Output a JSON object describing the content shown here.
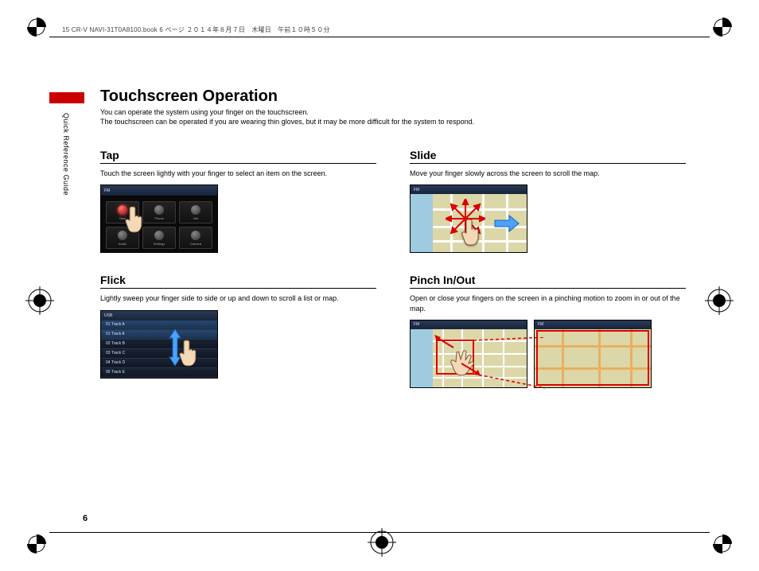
{
  "header_meta": "15 CR-V NAVI-31T0A8100.book  6 ページ  ２０１４年８月７日　木曜日　午前１０時５０分",
  "vertical_label": "Quick Reference Guide",
  "page_number": "6",
  "title": "Touchscreen Operation",
  "intro_line1": "You can operate the system using your finger on the touchscreen.",
  "intro_line2": "The touchscreen can be operated if you are wearing thin gloves, but it may be more difficult for the system to respond.",
  "sections": {
    "tap": {
      "heading": "Tap",
      "desc": "Touch the screen lightly with your finger to select an item on the screen.",
      "cells": [
        "Navi",
        "Phone",
        "Info",
        "Audio",
        "Settings",
        "Camera"
      ],
      "topbar": "FM"
    },
    "flick": {
      "heading": "Flick",
      "desc": "Lightly sweep your finger side to side or up and down to scroll a list or map.",
      "topbar": "USB",
      "header_row": "01 Track A",
      "rows": [
        "01 Track A",
        "02 Track B",
        "03 Track C",
        "04 Track D",
        "05 Track E"
      ]
    },
    "slide": {
      "heading": "Slide",
      "desc": "Move your finger slowly across the screen to scroll the map.",
      "topbar": "FM"
    },
    "pinch": {
      "heading": "Pinch In/Out",
      "desc": "Open or close your fingers on the screen in a pinching motion to zoom in or out of the map.",
      "topbar": "FM"
    }
  }
}
